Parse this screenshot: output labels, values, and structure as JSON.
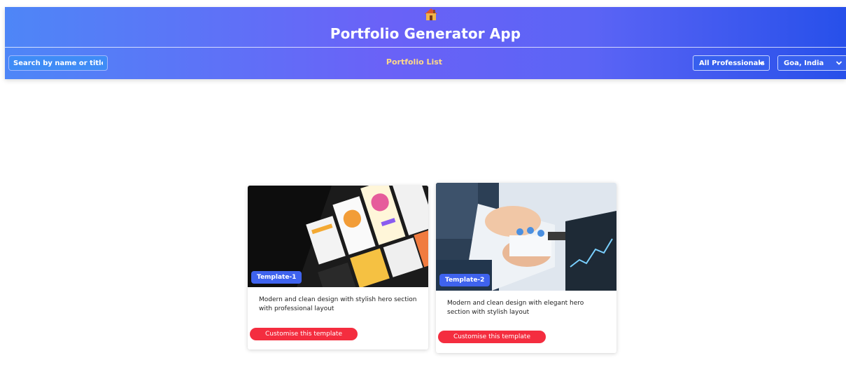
{
  "header": {
    "logo_icon": "house-icon",
    "title": "Portfolio Generator App",
    "search": {
      "placeholder": "Search by name or title..."
    },
    "list_title": "Portfolio List",
    "filters": {
      "profession": {
        "selected": "All Professionals"
      },
      "location": {
        "selected": "Goa, India"
      }
    }
  },
  "templates": [
    {
      "badge": "Template-1",
      "description": "Modern and clean design with stylish hero section with professional layout",
      "cta": "Customise this template"
    },
    {
      "badge": "Template-2",
      "description": "Modern and clean design with elegant hero section with stylish layout",
      "cta": "Customise this template"
    }
  ],
  "colors": {
    "header_start": "#4e86f7",
    "header_end": "#2750ea",
    "badge": "#3f63ee",
    "cta": "#f42d3f",
    "list_title": "#ffd98a"
  }
}
